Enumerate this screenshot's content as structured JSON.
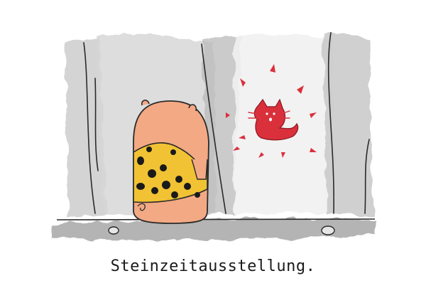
{
  "caption": "Steinzeitausstellung.",
  "colors": {
    "background": "#ffffff",
    "cave_wall": "#cfcfcf",
    "cave_floor": "#bdbdbd",
    "creature_body": "#f3a984",
    "leopard_tunic": "#f1c233",
    "cave_painting": "#d9303c",
    "ink": "#1a1a1a"
  },
  "elements": {
    "figure": "caveman-creature",
    "painting": "cave-painting-cat",
    "scene": "cave"
  }
}
